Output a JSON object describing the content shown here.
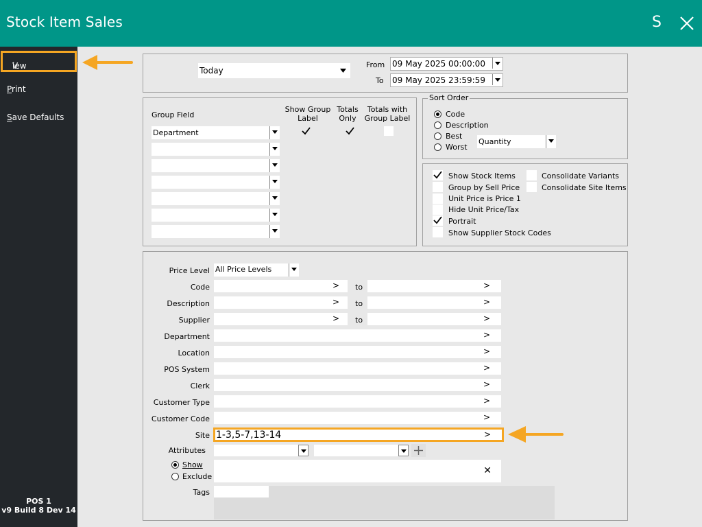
{
  "window": {
    "title": "Stock Item Sales",
    "s_label": "S"
  },
  "sidebar": {
    "items": [
      {
        "label": "View",
        "hotkey": "V"
      },
      {
        "label": "Print",
        "hotkey": "P"
      },
      {
        "label": "Save Defaults",
        "hotkey": "S"
      }
    ],
    "footer_line1": "POS 1",
    "footer_line2": "v9 Build 8 Dev 14"
  },
  "date": {
    "period": "Today",
    "from_label": "From",
    "from_value": "09 May 2025 00:00:00",
    "to_label": "To",
    "to_value": "09 May 2025 23:59:59"
  },
  "grouping": {
    "group_field_label": "Group Field",
    "show_group_label_header": "Show  Group\nLabel",
    "show_label_line1": "Show  Group",
    "show_label_line2": "Label",
    "totals_only_line1": "Totals",
    "totals_only_line2": "Only",
    "totals_with_line1": "Totals with",
    "totals_with_line2": "Group Label",
    "rows": [
      {
        "value": "Department",
        "show_label": true,
        "totals_only": true,
        "totals_with": false
      },
      {
        "value": ""
      },
      {
        "value": ""
      },
      {
        "value": ""
      },
      {
        "value": ""
      },
      {
        "value": ""
      },
      {
        "value": ""
      }
    ]
  },
  "sort_order": {
    "legend": "Sort Order",
    "options": [
      "Code",
      "Description",
      "Best",
      "Worst"
    ],
    "selected": "Code",
    "best_worst_by": "Quantity"
  },
  "options": {
    "show_stock_items": "Show Stock Items",
    "group_by_sell_price": "Group by Sell Price",
    "unit_price_is_price1": "Unit Price is Price 1",
    "hide_unit_price_tax": "Hide Unit Price/Tax",
    "portrait": "Portrait",
    "show_supplier_stock_codes": "Show Supplier Stock Codes",
    "consolidate_variants": "Consolidate Variants",
    "consolidate_site_items": "Consolidate Site Items"
  },
  "filters": {
    "price_level_label": "Price Level",
    "price_level_value": "All Price Levels",
    "code_label": "Code",
    "description_label": "Description",
    "supplier_label": "Supplier",
    "to_label": "to",
    "department_label": "Department",
    "location_label": "Location",
    "pos_system_label": "POS System",
    "clerk_label": "Clerk",
    "customer_type_label": "Customer Type",
    "customer_code_label": "Customer Code",
    "site_label": "Site",
    "site_value": "1-3,5-7,13-14",
    "attributes_label": "Attributes",
    "show_label": "Show",
    "exclude_label": "Exclude",
    "tags_label": "Tags",
    "more_glyph": ">",
    "clear_glyph": "✕",
    "add_glyph": "+"
  },
  "colors": {
    "titlebar": "#009688",
    "sidebar": "#23272b",
    "highlight": "#f5a623"
  }
}
